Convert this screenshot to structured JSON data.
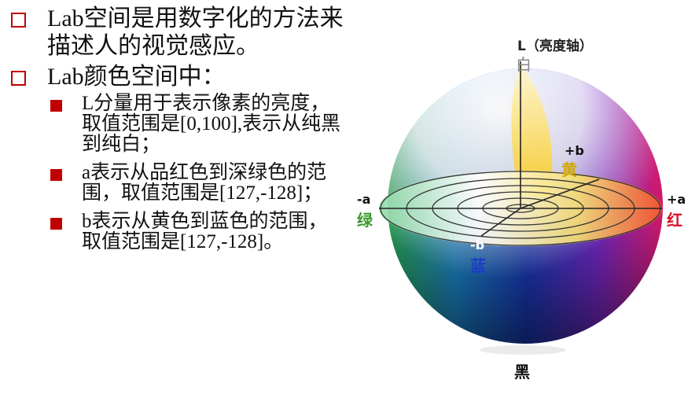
{
  "bullets": [
    {
      "text": "Lab空间是用数字化的方法来描述人的视觉感应。"
    },
    {
      "text": "Lab颜色空间中：",
      "subitems": [
        "L分量用于表示像素的亮度，取值范围是[0,100],表示从纯黑到纯白；",
        "a表示从品红色到深绿色的范围，取值范围是[127,-128]；",
        "b表示从黄色到蓝色的范围，取值范围是[127,-128]。"
      ]
    }
  ],
  "figure": {
    "l_axis": "L（亮度轴）",
    "white": "白",
    "black": "黑",
    "plus_b": "+b",
    "yellow": "黄",
    "minus_a": "-a",
    "green": "绿",
    "plus_a": "+a",
    "red": "红",
    "minus_b": "-b",
    "blue": "蓝"
  },
  "colors": {
    "bullet": "#c00000",
    "green": "#3a9a2a",
    "yellow": "#d4a800",
    "red": "#d8102a",
    "blue": "#1a3cc8"
  }
}
